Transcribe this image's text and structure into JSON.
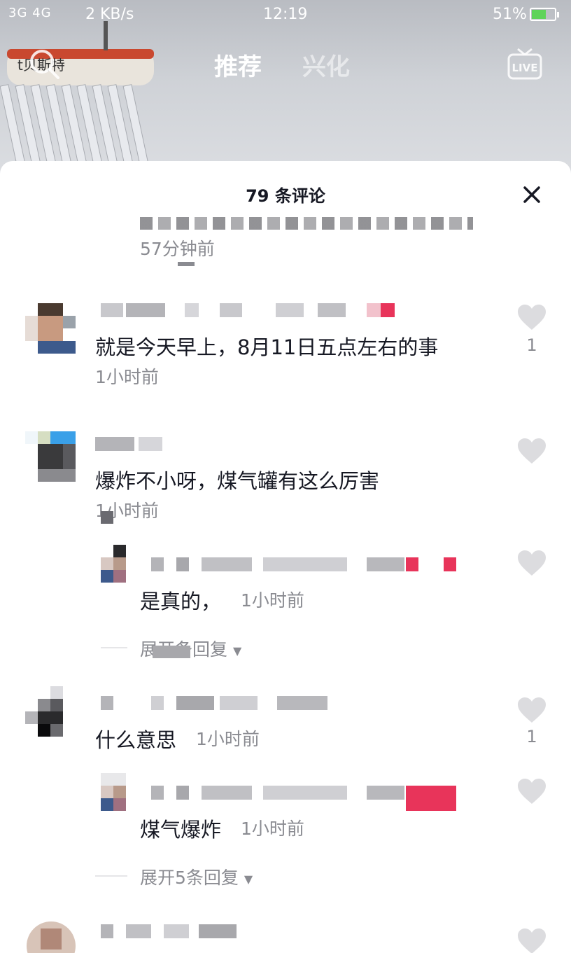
{
  "status_bar": {
    "signal": "3G 4G",
    "net_speed": "2 KB/s",
    "time": "12:19",
    "battery": "51%",
    "battery_level": 0.51
  },
  "top_nav": {
    "tabs": [
      {
        "label": "推荐",
        "active": true
      },
      {
        "label": "兴化",
        "active": false
      }
    ],
    "search_icon": "search-icon",
    "live_icon": "live-icon"
  },
  "comments_sheet": {
    "title": "79 条评论",
    "close_icon": "close-icon",
    "comments": [
      {
        "time": "57分钟前",
        "truncated": true
      },
      {
        "text": "就是今天早上，8月11日五点左右的事",
        "time": "1小时前",
        "likes": "1"
      },
      {
        "text": "爆炸不小呀，煤气罐有这么厉害",
        "time": "1小时前",
        "likes": "",
        "replies": [
          {
            "text": "是真的，",
            "time": "1小时前",
            "likes": ""
          }
        ],
        "expand_label": "展开条回复"
      },
      {
        "text": "什么意思",
        "time": "1小时前",
        "likes": "1",
        "replies": [
          {
            "text": "煤气爆炸",
            "time": "1小时前",
            "likes": ""
          }
        ],
        "expand_label": "展开5条回复"
      }
    ]
  },
  "colors": {
    "text_primary": "#161823",
    "text_secondary": "#8a8b91",
    "battery_fill": "#5fd35a",
    "pixel_red": "#e8345a"
  }
}
